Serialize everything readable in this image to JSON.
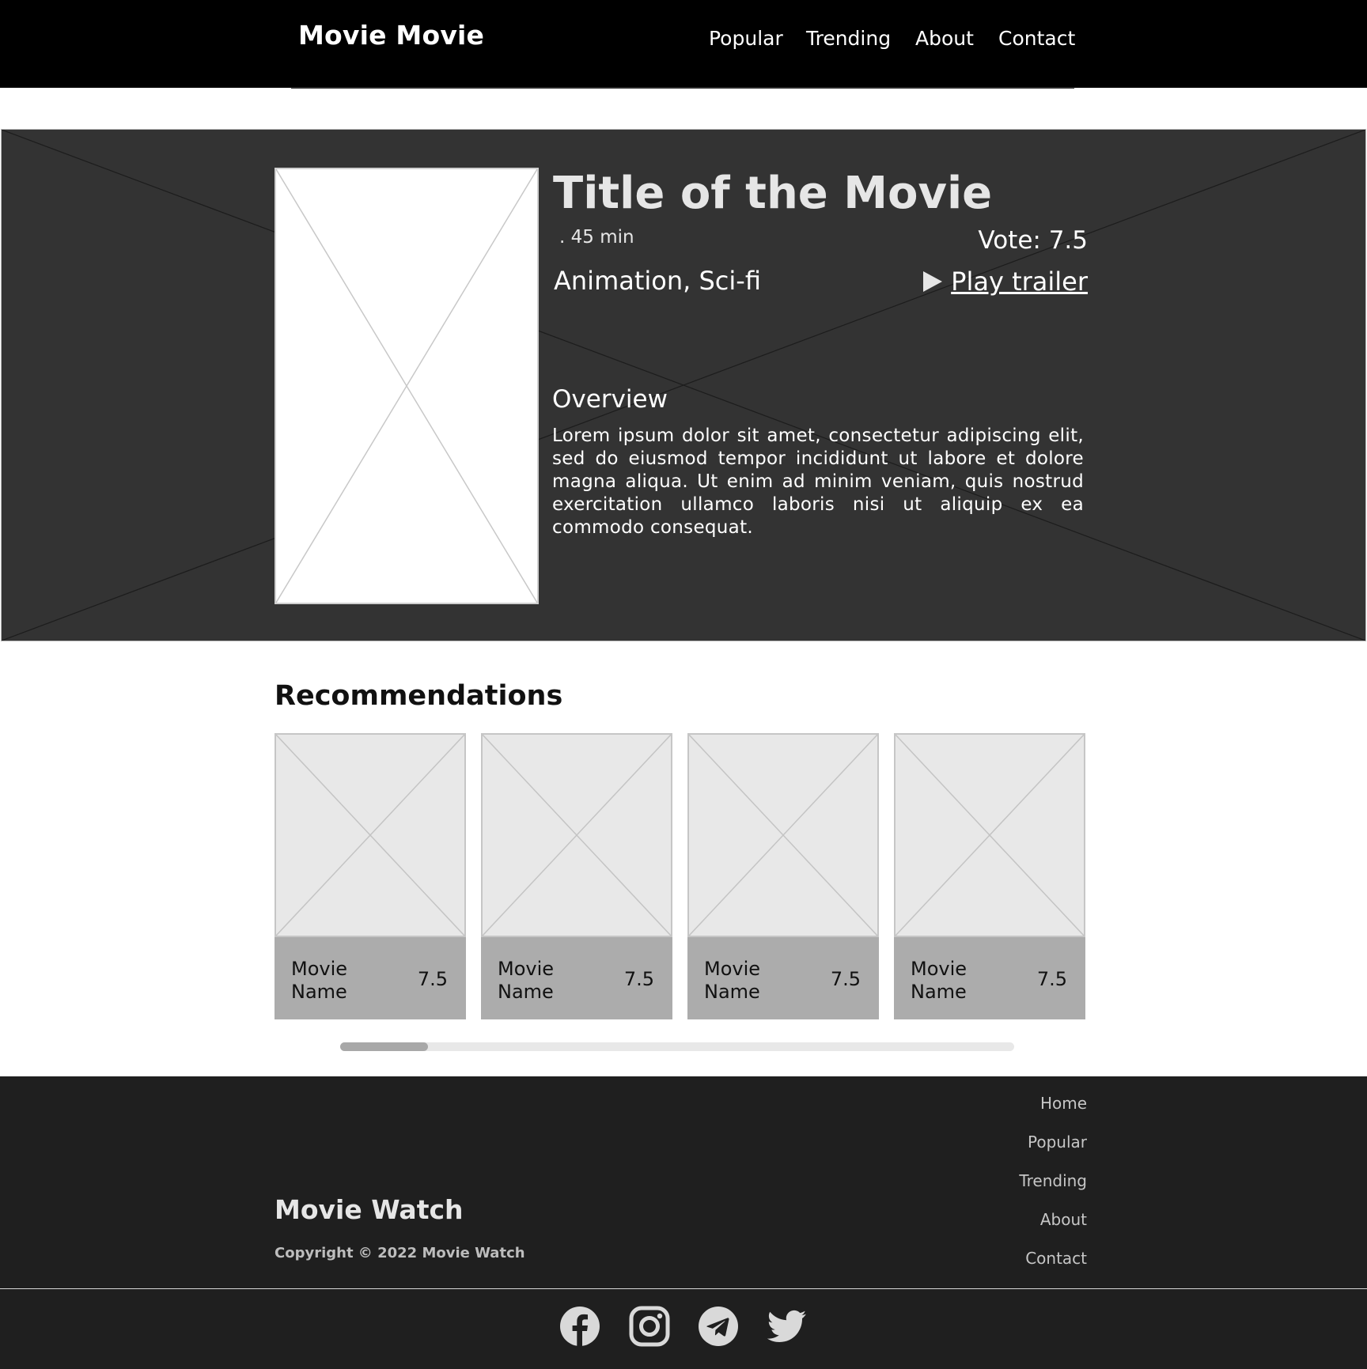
{
  "header": {
    "brand": "Movie Movie",
    "nav": [
      "Popular",
      "Trending",
      "About",
      "Contact"
    ]
  },
  "hero": {
    "title": "Title of  the Movie",
    "runtime": ". 45 min",
    "vote": "Vote: 7.5",
    "genres": "Animation, Sci-fi",
    "trailer_label": "Play trailer",
    "trailer_icon": "play-icon",
    "overview_heading": "Overview",
    "overview_text": "Lorem ipsum dolor sit amet, consectetur adipiscing elit, sed do eiusmod tempor incididunt ut labore et dolore magna aliqua. Ut enim ad minim veniam, quis nostrud exercitation ullamco laboris nisi ut aliquip ex ea commodo consequat."
  },
  "recommendations": {
    "heading": "Recommendations",
    "items": [
      {
        "name": "Movie Name",
        "vote": "7.5"
      },
      {
        "name": "Movie Name",
        "vote": "7.5"
      },
      {
        "name": "Movie Name",
        "vote": "7.5"
      },
      {
        "name": "Movie Name",
        "vote": "7.5"
      }
    ],
    "scroll_position_fraction": 0.13
  },
  "footer": {
    "brand": "Movie Watch",
    "copyright": "Copyright © 2022 Movie Watch",
    "links": [
      "Home",
      "Popular",
      "Trending",
      "About",
      "Contact"
    ],
    "social_icons": [
      "facebook-icon",
      "instagram-icon",
      "telegram-icon",
      "twitter-icon"
    ]
  },
  "colors": {
    "header_bg": "#000000",
    "hero_bg": "#333333",
    "card_info_bg": "#acacac",
    "footer_bg": "#1f1f1f",
    "placeholder_bg": "#e8e8e8"
  }
}
